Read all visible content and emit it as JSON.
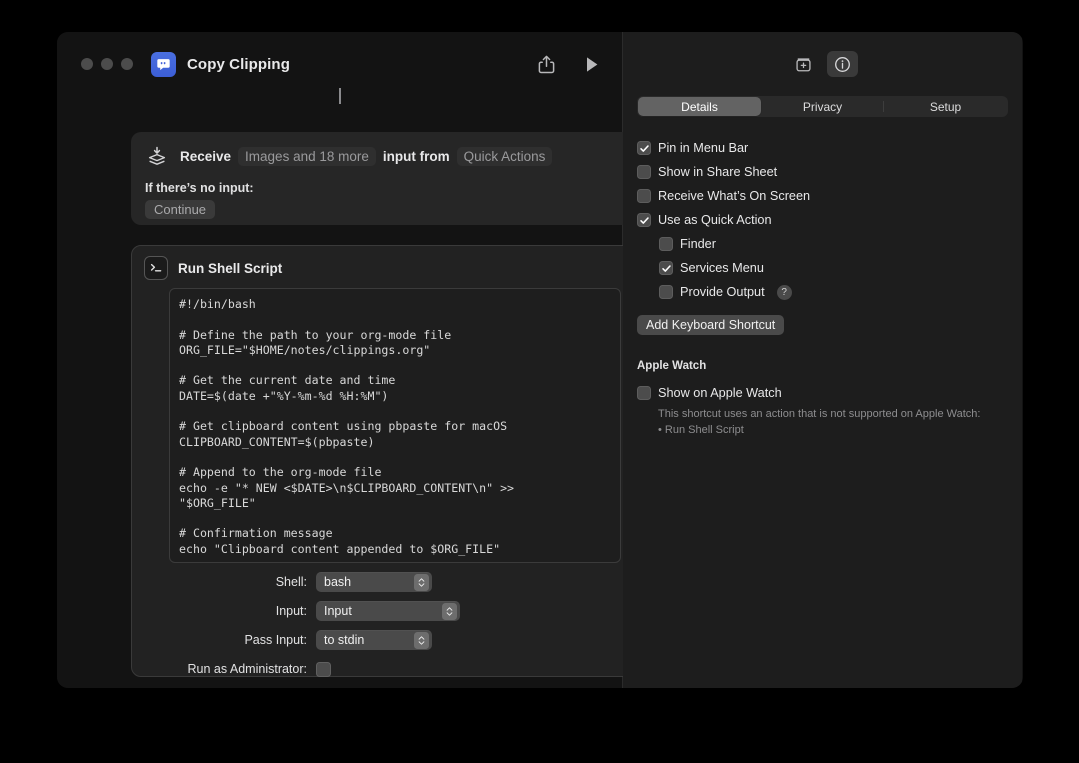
{
  "window": {
    "title": "Copy Clipping",
    "app_icon": "speech-bubble-icon",
    "accent_color": "#4161d8",
    "background": "#131313",
    "traffic_lights": [
      "close",
      "minimize",
      "zoom"
    ],
    "actions": [
      {
        "name": "share-button",
        "icon": "share-icon"
      },
      {
        "name": "run-button",
        "icon": "play-icon"
      }
    ]
  },
  "receive_card": {
    "icon": "receive-layers-icon",
    "verb": "Receive",
    "types_pill": "Images and 18 more",
    "connector": "input from",
    "source_pill": "Quick Actions",
    "no_input_label": "If there’s no input:",
    "no_input_value": "Continue"
  },
  "shell_card": {
    "icon": "terminal-icon",
    "title": "Run Shell Script",
    "script": "#!/bin/bash\n\n# Define the path to your org-mode file\nORG_FILE=\"$HOME/notes/clippings.org\"\n\n# Get the current date and time\nDATE=$(date +\"%Y-%m-%d %H:%M\")\n\n# Get clipboard content using pbpaste for macOS\nCLIPBOARD_CONTENT=$(pbpaste)\n\n# Append to the org-mode file\necho -e \"* NEW <$DATE>\\n$CLIPBOARD_CONTENT\\n\" >>\n\"$ORG_FILE\"\n\n# Confirmation message\necho \"Clipboard content appended to $ORG_FILE\"",
    "fields": [
      {
        "label": "Shell:",
        "value": "bash"
      },
      {
        "label": "Input:",
        "value": "Input"
      },
      {
        "label": "Pass Input:",
        "value": "to stdin"
      }
    ],
    "admin_label": "Run as Administrator:",
    "admin_checked": false
  },
  "inspector": {
    "toolbar": [
      {
        "name": "add-action-button",
        "icon": "add-action-icon",
        "active": false
      },
      {
        "name": "shortcut-details-button",
        "icon": "info-circle-icon",
        "active": true
      }
    ],
    "tabs": [
      {
        "label": "Details",
        "selected": true
      },
      {
        "label": "Privacy",
        "selected": false
      },
      {
        "label": "Setup",
        "selected": false
      }
    ],
    "options": [
      {
        "label": "Pin in Menu Bar",
        "checked": true,
        "indent": false,
        "help": false
      },
      {
        "label": "Show in Share Sheet",
        "checked": false,
        "indent": false,
        "help": false
      },
      {
        "label": "Receive What’s On Screen",
        "checked": false,
        "indent": false,
        "help": false
      },
      {
        "label": "Use as Quick Action",
        "checked": true,
        "indent": false,
        "help": false
      },
      {
        "label": "Finder",
        "checked": false,
        "indent": true,
        "help": false
      },
      {
        "label": "Services Menu",
        "checked": true,
        "indent": true,
        "help": false
      },
      {
        "label": "Provide Output",
        "checked": false,
        "indent": true,
        "help": true,
        "help_glyph": "?"
      }
    ],
    "keyboard_shortcut_button": "Add Keyboard Shortcut",
    "apple_watch": {
      "header": "Apple Watch",
      "option_label": "Show on Apple Watch",
      "option_checked": false,
      "note_line1": "This shortcut uses an action that is not supported on Apple Watch:",
      "note_line2": "• Run Shell Script"
    }
  }
}
